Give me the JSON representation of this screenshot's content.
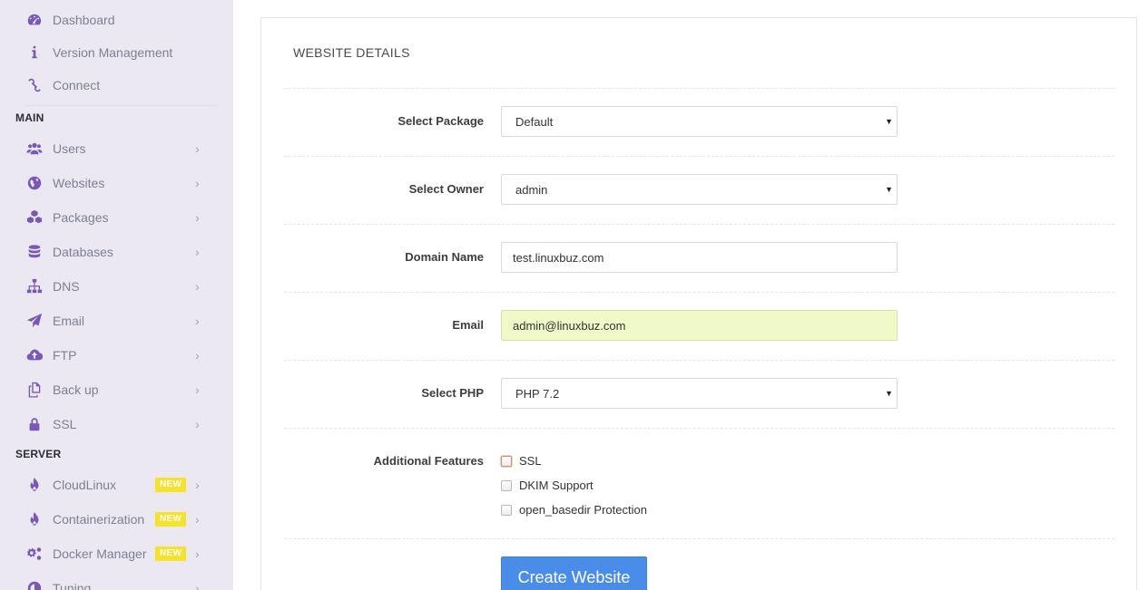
{
  "sidebar": {
    "top_items": [
      {
        "label": "Dashboard",
        "icon": "dashboard-icon"
      },
      {
        "label": "Version Management",
        "icon": "info-icon"
      },
      {
        "label": "Connect",
        "icon": "link-icon"
      }
    ],
    "main_header": "MAIN",
    "main_items": [
      {
        "label": "Users",
        "icon": "users-icon",
        "chevron": "›"
      },
      {
        "label": "Websites",
        "icon": "globe-icon",
        "chevron": "›"
      },
      {
        "label": "Packages",
        "icon": "cubes-icon",
        "chevron": "›"
      },
      {
        "label": "Databases",
        "icon": "database-icon",
        "chevron": "›"
      },
      {
        "label": "DNS",
        "icon": "sitemap-icon",
        "chevron": "›"
      },
      {
        "label": "Email",
        "icon": "paper-plane-icon",
        "chevron": "›"
      },
      {
        "label": "FTP",
        "icon": "cloud-upload-icon",
        "chevron": "›"
      },
      {
        "label": "Back up",
        "icon": "copy-icon",
        "chevron": "›"
      },
      {
        "label": "SSL",
        "icon": "lock-icon",
        "chevron": "›"
      }
    ],
    "server_header": "SERVER",
    "server_items": [
      {
        "label": "CloudLinux",
        "icon": "fire-icon",
        "badge": "NEW",
        "chevron": "›"
      },
      {
        "label": "Containerization",
        "icon": "fire-icon",
        "badge": "NEW",
        "chevron": "›"
      },
      {
        "label": "Docker Manager",
        "icon": "cogs-icon",
        "badge": "NEW",
        "chevron": "›"
      },
      {
        "label": "Tuning",
        "icon": "tuning-icon",
        "chevron": "›"
      }
    ]
  },
  "panel": {
    "title": "WEBSITE DETAILS",
    "fields": {
      "package": {
        "label": "Select Package",
        "value": "Default"
      },
      "owner": {
        "label": "Select Owner",
        "value": "admin"
      },
      "domain": {
        "label": "Domain Name",
        "value": "test.linuxbuz.com"
      },
      "email": {
        "label": "Email",
        "value": "admin@linuxbuz.com"
      },
      "php": {
        "label": "Select PHP",
        "value": "PHP 7.2"
      }
    },
    "features": {
      "label": "Additional Features",
      "options": [
        {
          "label": "SSL",
          "checked": false
        },
        {
          "label": "DKIM Support",
          "checked": false
        },
        {
          "label": "open_basedir Protection",
          "checked": false
        }
      ]
    },
    "submit_label": "Create Website",
    "caret": "▼"
  },
  "colors": {
    "accent": "#7a58b8",
    "sidebar_bg": "#ece8f1",
    "badge": "#f5e22b",
    "button": "#4a8de8",
    "autofill": "#f0fac8"
  }
}
